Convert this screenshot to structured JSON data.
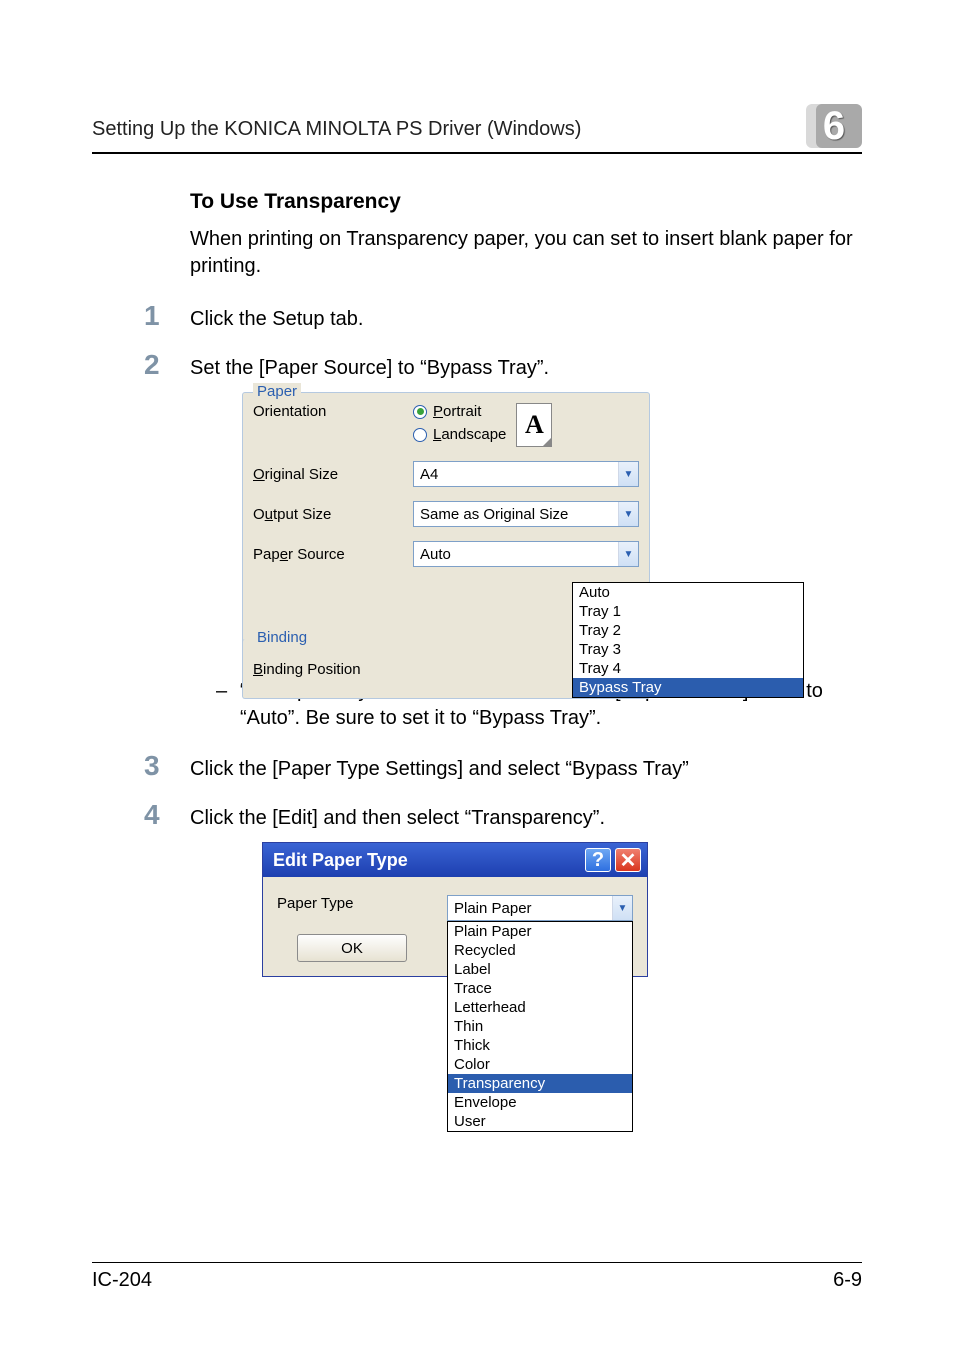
{
  "header": {
    "title": "Setting Up the KONICA MINOLTA PS Driver (Windows)",
    "chapter_number": "6"
  },
  "section": {
    "heading": "To Use Transparency",
    "intro": "When printing on Transparency paper, you can set to insert blank paper for printing."
  },
  "steps": {
    "s1": {
      "num": "1",
      "text": "Click the Setup tab."
    },
    "s2": {
      "num": "2",
      "text": "Set the [Paper Source] to “Bypass Tray”."
    },
    "s3": {
      "num": "3",
      "text": "Click the [Paper Type Settings] and select “Bypass Tray”"
    },
    "s4": {
      "num": "4",
      "text": "Click the [Edit] and then select “Transparency”."
    }
  },
  "note": "“Transparency Interleave” cannot be set if [Paper Source] is set to “Auto”. Be sure to set it to “Bypass Tray”.",
  "figure1": {
    "group_paper": "Paper",
    "orientation_label": "Orientation",
    "portrait": "Portrait",
    "landscape": "Landscape",
    "orient_glyph": "A",
    "original_size_label": "Original Size",
    "original_size_value": "A4",
    "output_size_label": "Output Size",
    "output_size_value": "Same as Original Size",
    "paper_source_label": "Paper Source",
    "paper_source_value": "Auto",
    "paper_source_options": [
      "Auto",
      "Tray 1",
      "Tray 2",
      "Tray 3",
      "Tray 4",
      "Bypass Tray"
    ],
    "group_binding": "Binding",
    "binding_position_label": "Binding Position"
  },
  "figure2": {
    "title": "Edit Paper Type",
    "paper_type_label": "Paper Type",
    "paper_type_value": "Plain Paper",
    "ok_label": "OK",
    "options": [
      "Plain Paper",
      "Recycled",
      "Label",
      "Trace",
      "Letterhead",
      "Thin",
      "Thick",
      "Color",
      "Transparency",
      "Envelope",
      "User"
    ]
  },
  "footer": {
    "left": "IC-204",
    "right": "6-9"
  }
}
